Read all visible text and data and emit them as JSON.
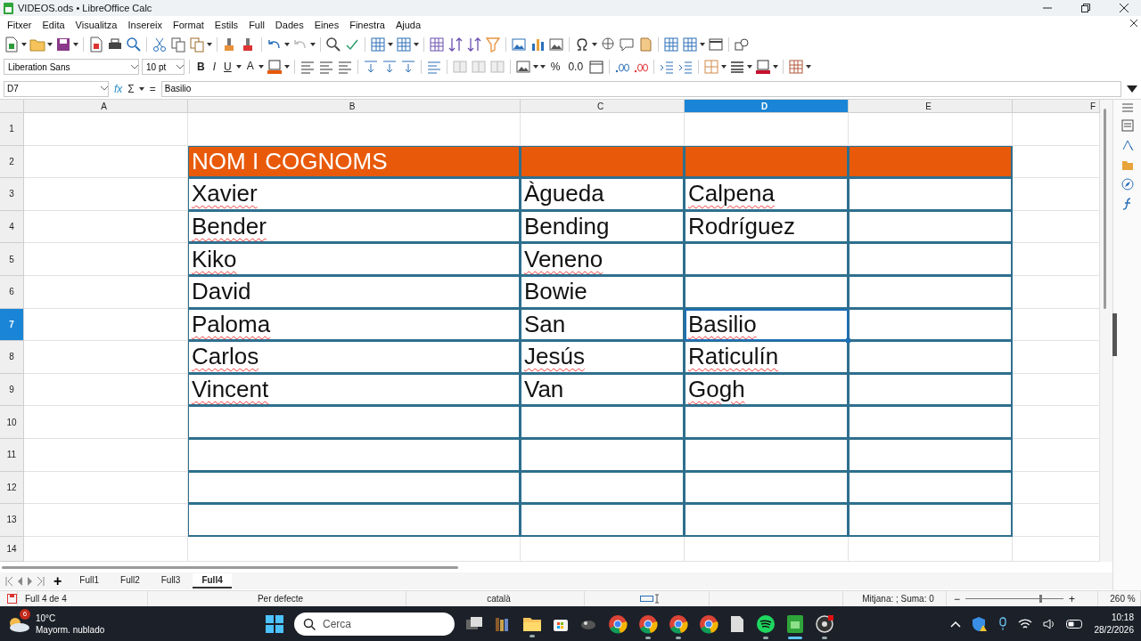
{
  "window": {
    "title": "VIDEOS.ods • LibreOffice Calc"
  },
  "menu": [
    "Fitxer",
    "Edita",
    "Visualitza",
    "Insereix",
    "Format",
    "Estils",
    "Full",
    "Dades",
    "Eines",
    "Finestra",
    "Ajuda"
  ],
  "font_name": {
    "value": "Liberation Sans"
  },
  "font_size": {
    "value": "10 pt"
  },
  "format_buttons": [
    {
      "label": "B",
      "kind": "bold"
    },
    {
      "label": "I",
      "kind": "italic"
    },
    {
      "label": "U",
      "kind": "underline"
    },
    {
      "label": "A",
      "kind": "fontcolor"
    }
  ],
  "number_buttons": [
    {
      "label": "%"
    },
    {
      "label": "0.0"
    }
  ],
  "formula_bar": {
    "name_box": "D7",
    "fx": "fx",
    "sum": "Σ",
    "equals": "=",
    "value": "Basilio"
  },
  "columns": [
    {
      "label": "A",
      "selected": false
    },
    {
      "label": "B",
      "selected": false
    },
    {
      "label": "C",
      "selected": false
    },
    {
      "label": "D",
      "selected": true
    },
    {
      "label": "E",
      "selected": false
    },
    {
      "label": "F",
      "selected": false
    }
  ],
  "rows": [
    {
      "label": "1",
      "selected": false,
      "kind": "plain",
      "cells": [
        null,
        null,
        null,
        null,
        null
      ]
    },
    {
      "label": "2",
      "selected": false,
      "kind": "header",
      "cells": [
        null,
        {
          "text": "NOM I COGNOMS",
          "misspelled": false
        },
        null,
        null,
        null
      ]
    },
    {
      "label": "3",
      "selected": false,
      "kind": "data",
      "cells": [
        null,
        {
          "text": "Xavier",
          "misspelled": true
        },
        {
          "text": "Àgueda",
          "misspelled": false
        },
        {
          "text": "Calpena",
          "misspelled": true
        },
        null
      ]
    },
    {
      "label": "4",
      "selected": false,
      "kind": "data",
      "cells": [
        null,
        {
          "text": "Bender",
          "misspelled": true
        },
        {
          "text": "Bending",
          "misspelled": false
        },
        {
          "text": "Rodríguez",
          "misspelled": false
        },
        null
      ]
    },
    {
      "label": "5",
      "selected": false,
      "kind": "data",
      "cells": [
        null,
        {
          "text": "Kiko",
          "misspelled": true
        },
        {
          "text": "Veneno",
          "misspelled": true
        },
        null,
        null
      ]
    },
    {
      "label": "6",
      "selected": false,
      "kind": "data",
      "cells": [
        null,
        {
          "text": "David",
          "misspelled": false
        },
        {
          "text": "Bowie",
          "misspelled": false
        },
        null,
        null
      ]
    },
    {
      "label": "7",
      "selected": true,
      "kind": "data",
      "cells": [
        null,
        {
          "text": "Paloma",
          "misspelled": true
        },
        {
          "text": "San",
          "misspelled": false
        },
        {
          "text": "Basilio",
          "misspelled": true
        },
        null
      ]
    },
    {
      "label": "8",
      "selected": false,
      "kind": "data",
      "cells": [
        null,
        {
          "text": "Carlos",
          "misspelled": true
        },
        {
          "text": "Jesús",
          "misspelled": true
        },
        {
          "text": "Raticulín",
          "misspelled": true
        },
        null
      ]
    },
    {
      "label": "9",
      "selected": false,
      "kind": "data",
      "cells": [
        null,
        {
          "text": "Vincent",
          "misspelled": true
        },
        {
          "text": "Van",
          "misspelled": false
        },
        {
          "text": "Gogh",
          "misspelled": true
        },
        null
      ]
    },
    {
      "label": "10",
      "selected": false,
      "kind": "data",
      "cells": [
        null,
        null,
        null,
        null,
        null
      ]
    },
    {
      "label": "11",
      "selected": false,
      "kind": "data",
      "cells": [
        null,
        null,
        null,
        null,
        null
      ]
    },
    {
      "label": "12",
      "selected": false,
      "kind": "data",
      "cells": [
        null,
        null,
        null,
        null,
        null
      ]
    },
    {
      "label": "13",
      "selected": false,
      "kind": "data",
      "cells": [
        null,
        null,
        null,
        null,
        null
      ]
    },
    {
      "label": "14",
      "selected": false,
      "kind": "plain",
      "cells": [
        null,
        null,
        null,
        null,
        null
      ]
    }
  ],
  "sheet_tabs": [
    {
      "label": "Full1",
      "selected": false
    },
    {
      "label": "Full2",
      "selected": false
    },
    {
      "label": "Full3",
      "selected": false
    },
    {
      "label": "Full4",
      "selected": true
    }
  ],
  "add_sheet": "+",
  "status_bar": {
    "sheet": "Full 4 de 4",
    "page_style": "Per defecte",
    "language": "català",
    "summary": "Mitjana: ; Suma: 0",
    "zoom_minus": "−",
    "zoom_plus": "+",
    "zoom": "260 %",
    "zoom_level": {
      "level": 0.75
    }
  },
  "taskbar": {
    "temperature": "10°C",
    "weather": "Mayorm. nublado",
    "badge": "6",
    "search": {
      "placeholder": "Cerca"
    },
    "time": "10:18",
    "date": "28/2/2026"
  }
}
